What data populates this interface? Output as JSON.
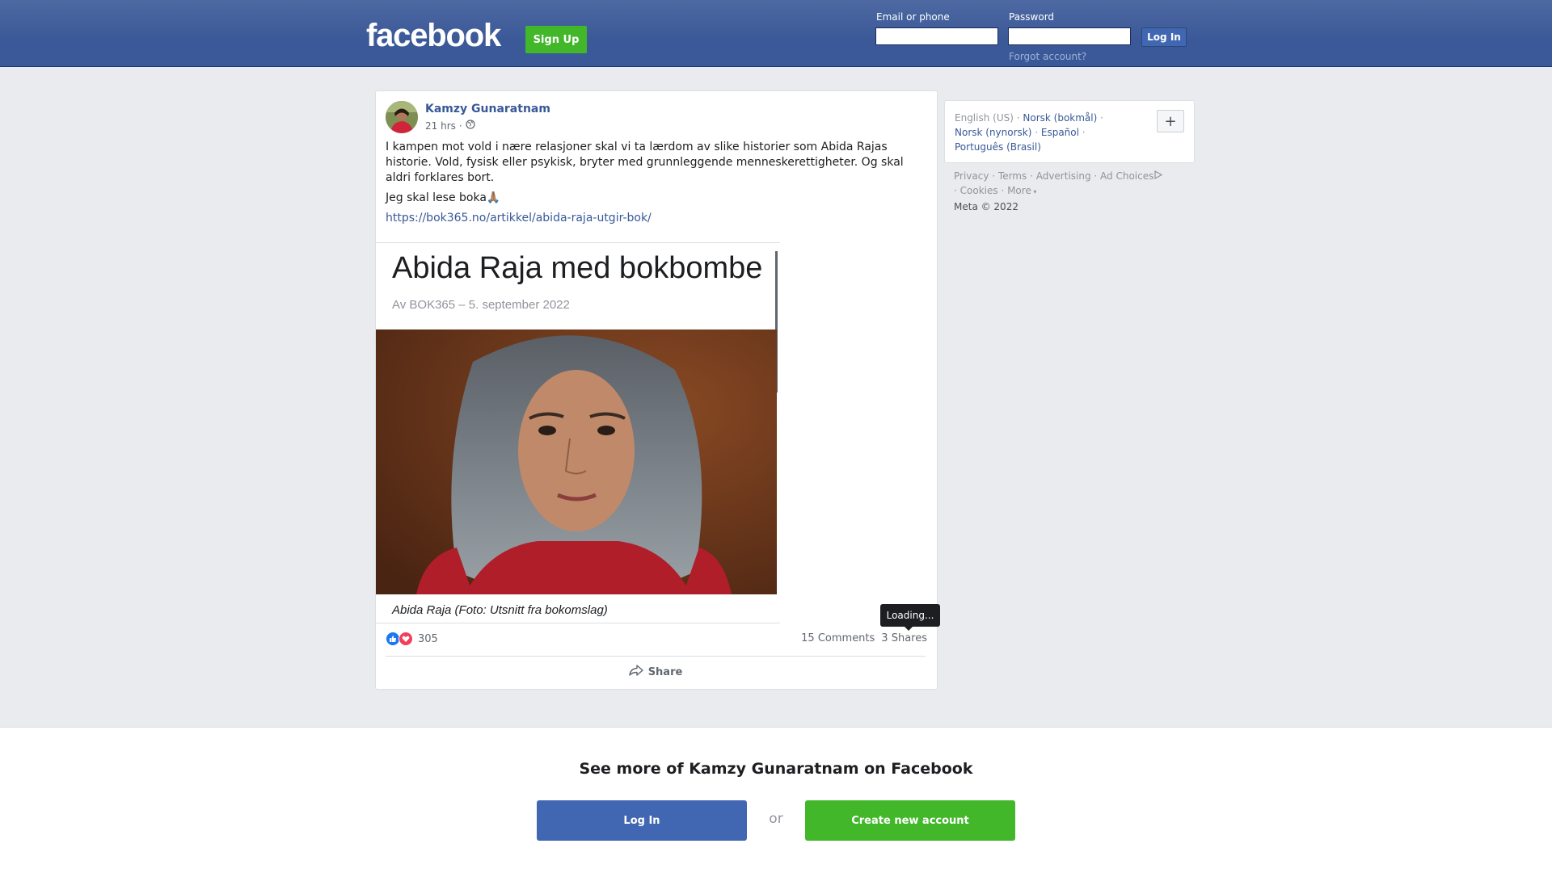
{
  "header": {
    "logo": "facebook",
    "signup_label": "Sign Up",
    "email_label": "Email or phone",
    "password_label": "Password",
    "login_label": "Log In",
    "forgot_label": "Forgot account?"
  },
  "post": {
    "author": "Kamzy Gunaratnam",
    "time": "21 hrs",
    "separator": "·",
    "audience_icon": "globe-icon",
    "paragraph_1": "I kampen mot vold i nære relasjoner skal vi ta lærdom av slike historier som Abida Rajas historie. Vold, fysisk eller psykisk, bryter med grunnleggende menneskerettigheter. Og skal aldri forklares bort.",
    "paragraph_2": "Jeg skal lese boka🙏🏽",
    "link": "https://bok365.no/artikkel/abida-raja-utgir-bok/",
    "preview": {
      "title": "Abida Raja med bokbombe",
      "byline": "Av  BOK365  –  5. september 2022",
      "caption": "Abida Raja (Foto: Utsnitt fra bokomslag)"
    },
    "reaction_count": "305",
    "comments": "15 Comments",
    "shares": "3 Shares",
    "tooltip": "Loading...",
    "share_label": "Share"
  },
  "sidebar": {
    "current_language": "English (US)",
    "languages": [
      "Norsk (bokmål)",
      "Norsk (nynorsk)",
      "Español",
      "Português (Brasil)"
    ],
    "plus_label": "+",
    "footer": {
      "privacy": "Privacy",
      "terms": "Terms",
      "advertising": "Advertising",
      "ad_choices": "Ad Choices",
      "cookies": "Cookies",
      "more": "More",
      "copyright": "Meta © 2022"
    }
  },
  "bottom": {
    "title": "See more of Kamzy Gunaratnam on Facebook",
    "login_label": "Log In",
    "or_label": "or",
    "create_label": "Create new account"
  },
  "colors": {
    "brand_blue": "#4267b2",
    "header_blue": "#3b5998",
    "green": "#42b72a",
    "link": "#385898"
  }
}
